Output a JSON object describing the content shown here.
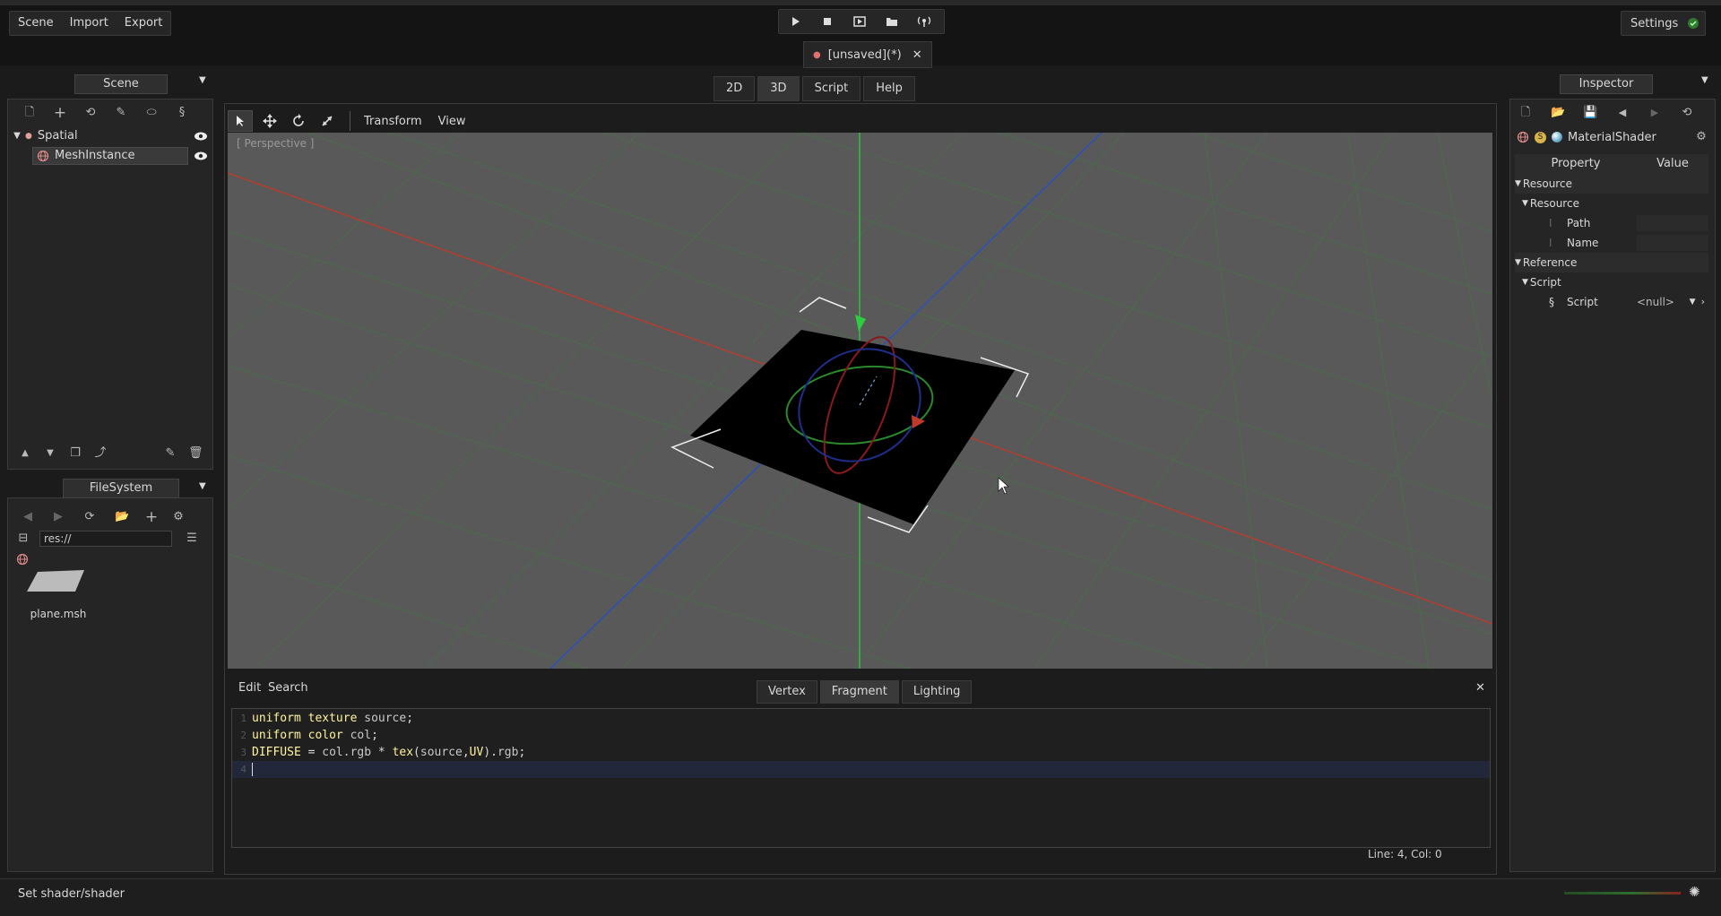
{
  "menu": {
    "scene": "Scene",
    "import": "Import",
    "export": "Export"
  },
  "settings": {
    "label": "Settings"
  },
  "scene_tab": {
    "label": "[unsaved](*)"
  },
  "view_tabs": [
    "2D",
    "3D",
    "Script",
    "Help"
  ],
  "scene_panel": {
    "title": "Scene",
    "tree": [
      {
        "label": "Spatial"
      },
      {
        "label": "MeshInstance"
      }
    ]
  },
  "filesystem": {
    "title": "FileSystem",
    "path": "res://",
    "files": [
      {
        "name": "plane.msh"
      }
    ]
  },
  "viewport": {
    "transform_menu": "Transform",
    "view_menu": "View",
    "perspective_label": "[ Perspective ]"
  },
  "shader_editor": {
    "menu_edit": "Edit",
    "menu_search": "Search",
    "tabs": [
      "Vertex",
      "Fragment",
      "Lighting"
    ],
    "active_tab": "Fragment",
    "line_numbers": [
      "1",
      "2",
      "3",
      "4"
    ],
    "cursor_status": "Line: 4, Col: 0"
  },
  "inspector": {
    "title": "Inspector",
    "object_name": "MaterialShader",
    "col_property": "Property",
    "col_value": "Value",
    "sections": {
      "resource": "Resource",
      "resource_sub": "Resource",
      "path": "Path",
      "name": "Name",
      "reference": "Reference",
      "script_sub": "Script",
      "script_prop": "Script",
      "script_value": "<null>"
    }
  },
  "status": {
    "message": "Set shader/shader"
  },
  "colors": {
    "x_axis": "#c0392b",
    "y_axis": "#2ecc40",
    "z_axis": "#2451c7",
    "grid": "#4a6a4a",
    "viewport_bg": "#5a5a5a",
    "keyword": "#fff4a0"
  }
}
